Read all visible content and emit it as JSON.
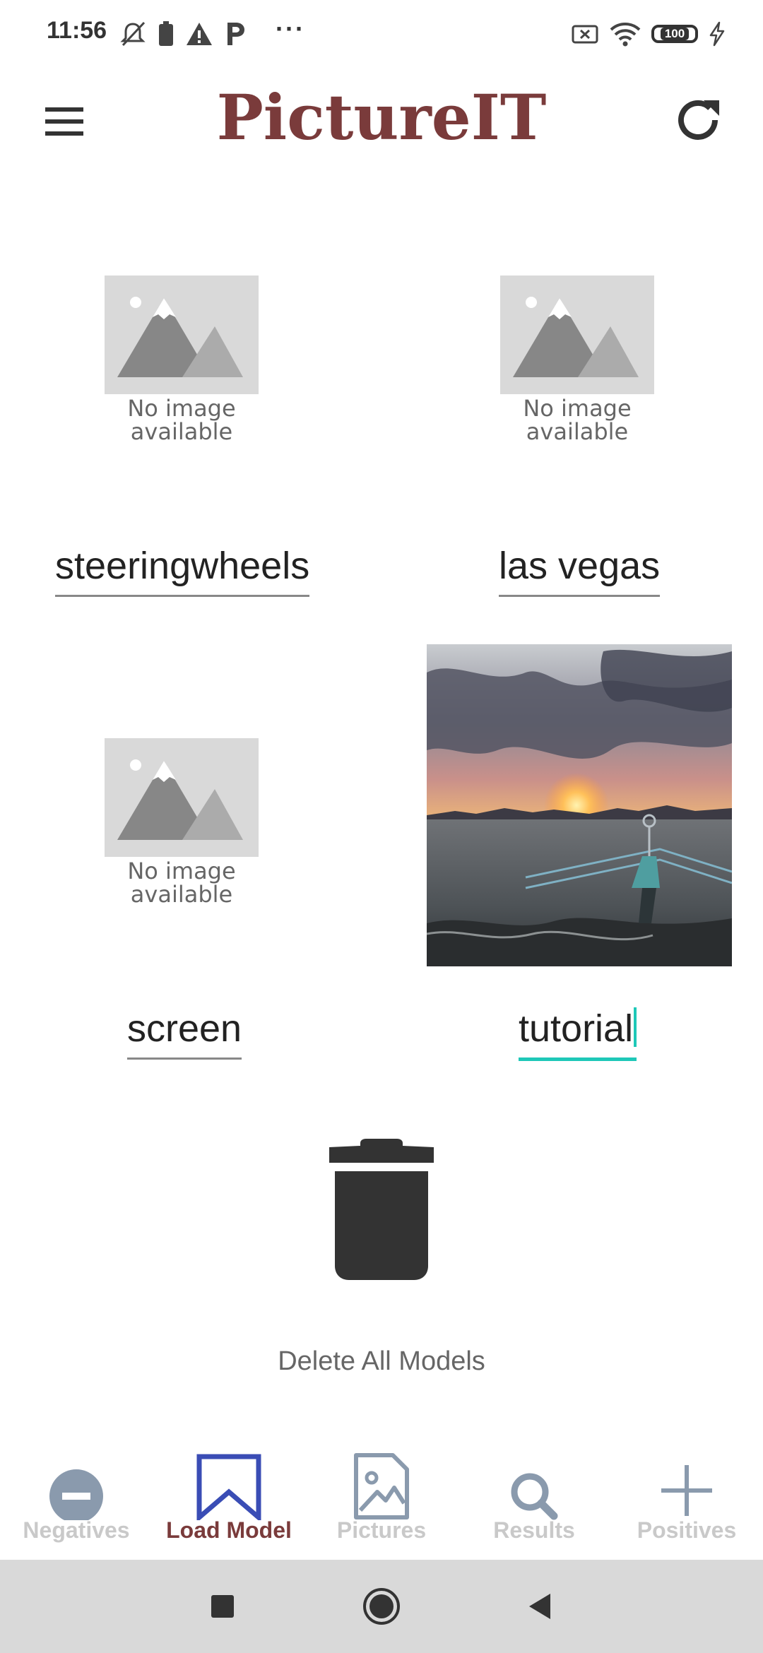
{
  "status_bar": {
    "time": "11:56",
    "overflow": "···",
    "battery_level": "100",
    "left_icons": [
      "mute-icon",
      "battery-saver-icon",
      "warning-icon",
      "parking-icon"
    ],
    "right_icons": [
      "no-sim-icon",
      "wifi-icon",
      "battery-icon",
      "charging-icon"
    ]
  },
  "app_bar": {
    "title": "PictureIT",
    "menu_icon": "hamburger-menu-icon",
    "refresh_icon": "refresh-icon"
  },
  "placeholder": {
    "line1": "No image",
    "line2": "available"
  },
  "models": [
    {
      "name": "steeringwheels",
      "has_image": false
    },
    {
      "name": "las vegas",
      "has_image": false
    },
    {
      "name": "screen",
      "has_image": false
    },
    {
      "name": "tutorial",
      "has_image": true,
      "focused": true
    }
  ],
  "delete": {
    "label": "Delete All Models",
    "icon": "trash-icon"
  },
  "bottom_nav": {
    "items": [
      {
        "label": "Negatives",
        "icon": "minus-circle-icon",
        "active": false
      },
      {
        "label": "Load Model",
        "icon": "bookmark-icon",
        "active": true
      },
      {
        "label": "Pictures",
        "icon": "image-file-icon",
        "active": false
      },
      {
        "label": "Results",
        "icon": "search-icon",
        "active": false
      },
      {
        "label": "Positives",
        "icon": "plus-icon",
        "active": false
      }
    ]
  },
  "colors": {
    "brand": "#7a3b3b",
    "active_underline": "#1ec8b8",
    "nav_active_icon": "#3a4db5",
    "nav_inactive_icon": "#8a9aad"
  }
}
